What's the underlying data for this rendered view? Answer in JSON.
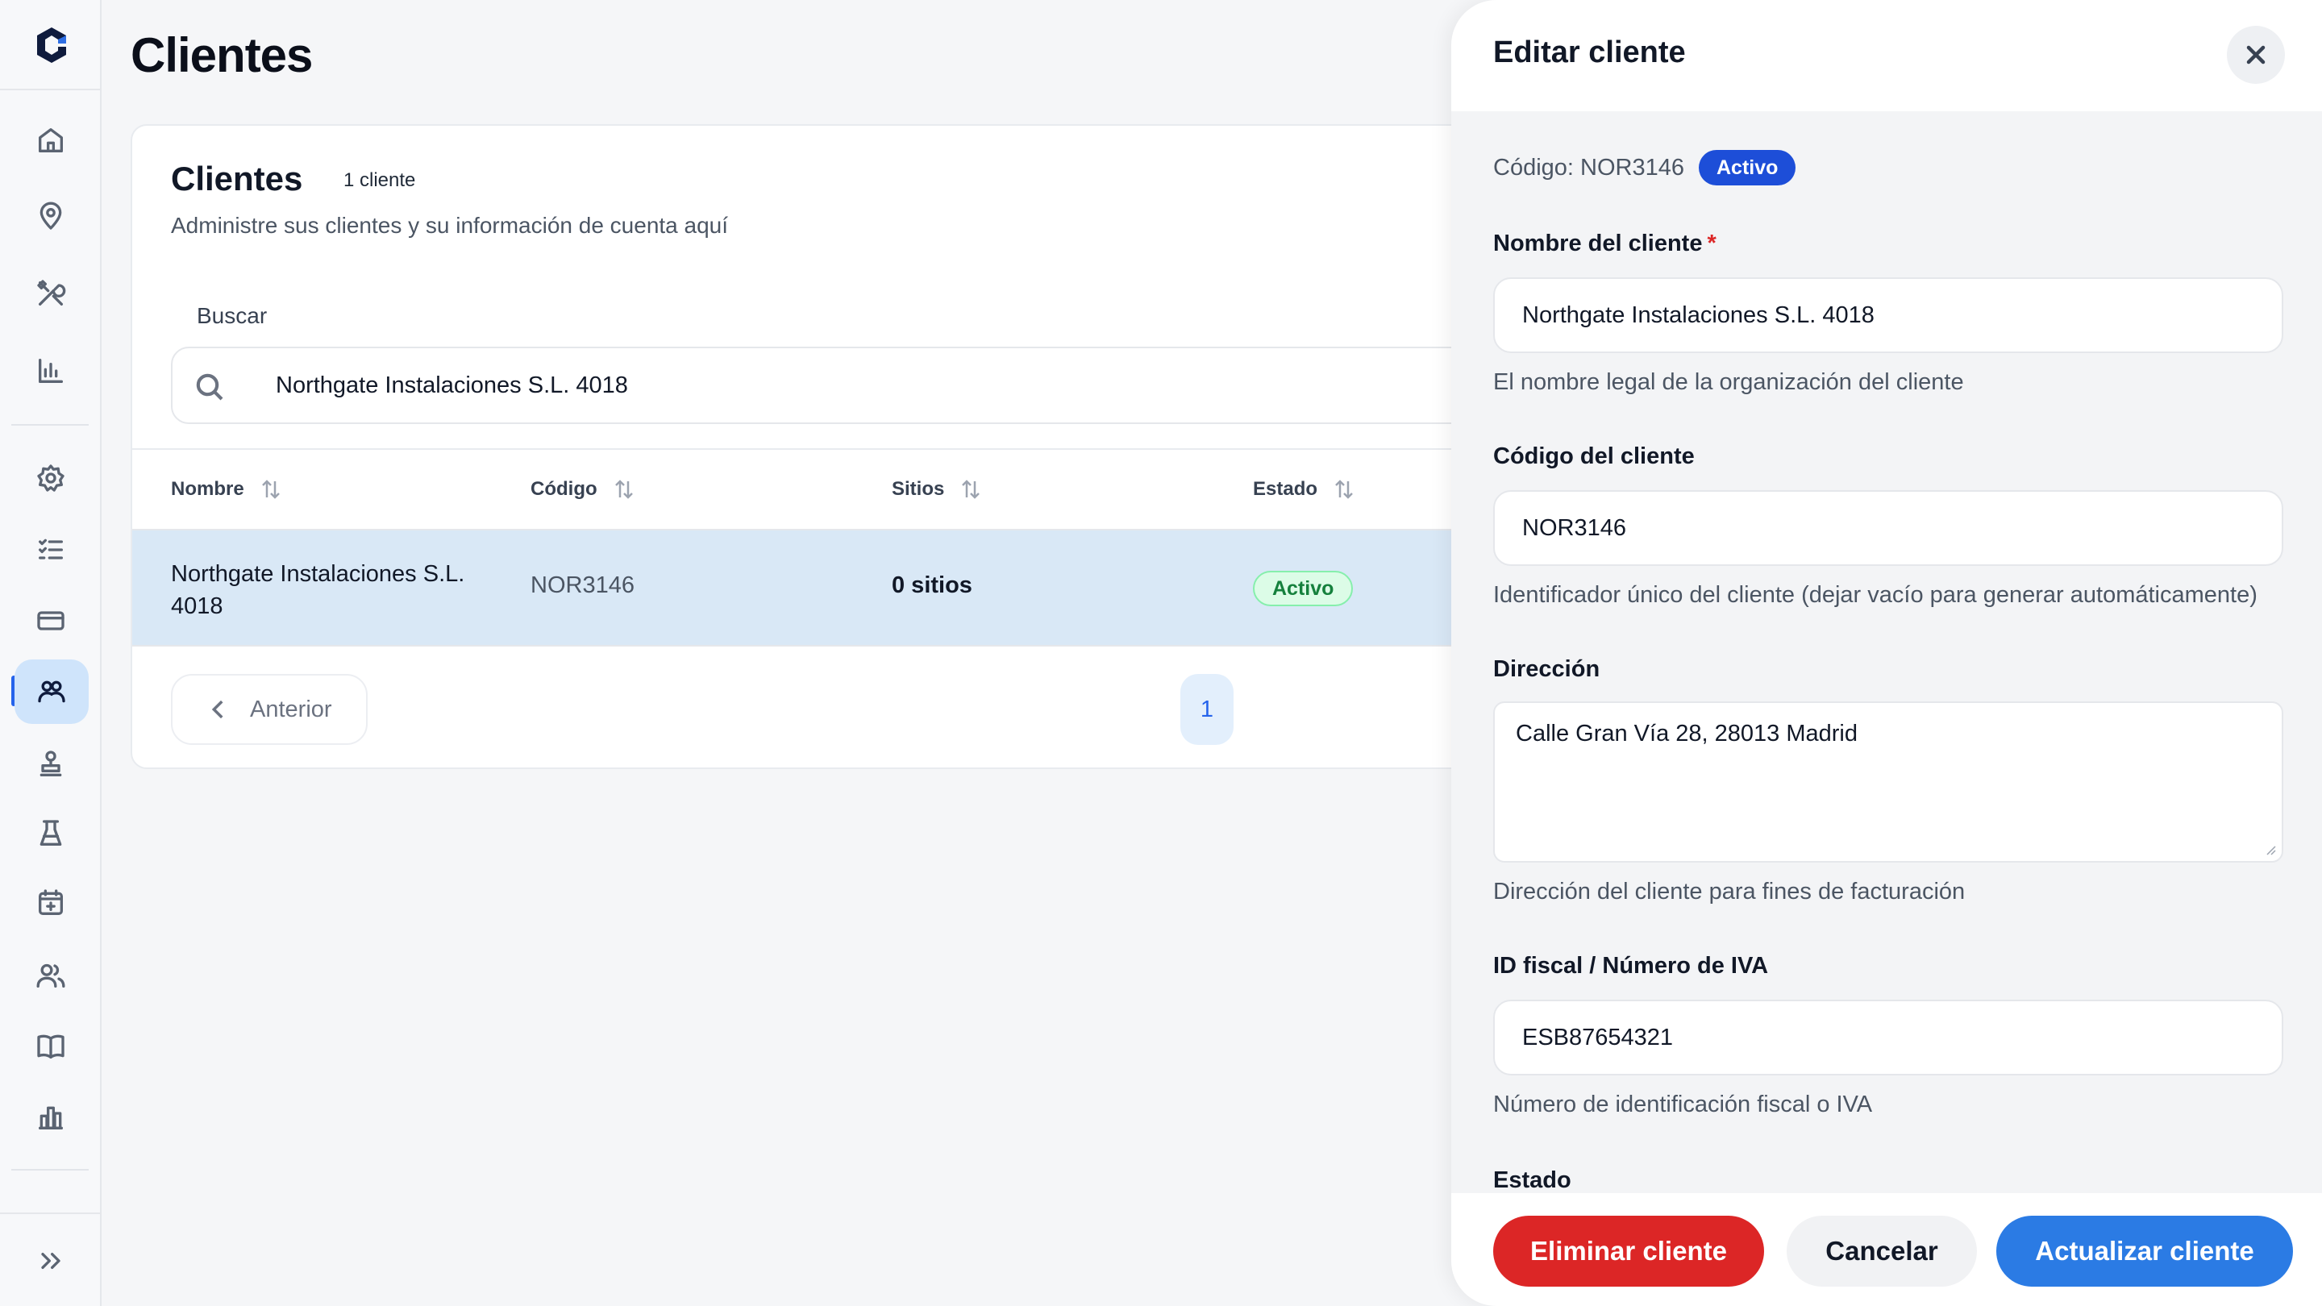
{
  "page": {
    "title": "Clientes"
  },
  "card": {
    "title": "Clientes",
    "count": "1 cliente",
    "subtitle": "Administre sus clientes y su información de cuenta aquí",
    "search_label": "Buscar",
    "search_value": "Northgate Instalaciones S.L. 4018"
  },
  "table": {
    "columns": [
      "Nombre",
      "Código",
      "Sitios",
      "Estado"
    ],
    "rows": [
      {
        "name": "Northgate Instalaciones S.L. 4018",
        "code": "NOR3146",
        "sites": "0 sitios",
        "status": "Activo"
      }
    ]
  },
  "pagination": {
    "prev_label": "Anterior",
    "current_page": "1"
  },
  "drawer": {
    "title": "Editar cliente",
    "code_label": "Código: NOR3146",
    "status_badge": "Activo",
    "fields": {
      "name": {
        "label": "Nombre del cliente",
        "required_mark": "*",
        "value": "Northgate Instalaciones S.L. 4018",
        "help": "El nombre legal de la organización del cliente"
      },
      "code": {
        "label": "Código del cliente",
        "value": "NOR3146",
        "help": "Identificador único del cliente (dejar vacío para generar automáticamente)"
      },
      "address": {
        "label": "Dirección",
        "value": "Calle Gran Vía 28, 28013 Madrid",
        "help": "Dirección del cliente para fines de facturación"
      },
      "tax_id": {
        "label": "ID fiscal / Número de IVA",
        "value": "ESB87654321",
        "help": "Número de identificación fiscal o IVA"
      },
      "status": {
        "label": "Estado"
      }
    },
    "buttons": {
      "delete": "Eliminar cliente",
      "cancel": "Cancelar",
      "update": "Actualizar cliente"
    }
  },
  "sidebar": {
    "items": [
      "home-icon",
      "map-pin-icon",
      "tools-icon",
      "bar-chart-icon",
      "settings-icon",
      "checklist-icon",
      "credit-card-icon",
      "clients-icon",
      "stamp-icon",
      "flask-icon",
      "calendar-icon",
      "users-icon",
      "book-icon",
      "building-chart-icon"
    ],
    "active": "clients-icon"
  },
  "colors": {
    "accent": "#2563eb",
    "danger": "#dc2626",
    "success": "#15803d",
    "selected_row": "#d9e8f6"
  }
}
